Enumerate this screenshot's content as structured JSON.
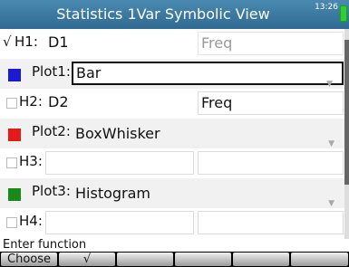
{
  "titlebar": {
    "title": "Statistics 1Var Symbolic View",
    "clock": "13:26",
    "sub": "ᴬᵀ"
  },
  "rows": {
    "h1": {
      "check": "√",
      "label": "H1:",
      "value": "D1",
      "freq": "Freq"
    },
    "plot1": {
      "label": "Plot1:",
      "value": "Bar",
      "color": "#1a1ad4"
    },
    "h2": {
      "label": "H2:",
      "value": "D2",
      "freq": "Freq"
    },
    "plot2": {
      "label": "Plot2:",
      "value": "BoxWhisker",
      "color": "#e41a1a"
    },
    "h3": {
      "label": "H3:"
    },
    "plot3": {
      "label": "Plot3:",
      "value": "Histogram",
      "color": "#1a8a1a"
    },
    "h4": {
      "label": "H4:"
    }
  },
  "status": {
    "text": "Enter function"
  },
  "softkeys": {
    "choose": "Choose",
    "check": "√",
    "k3": "",
    "k4": "",
    "k5": "",
    "k6": ""
  }
}
